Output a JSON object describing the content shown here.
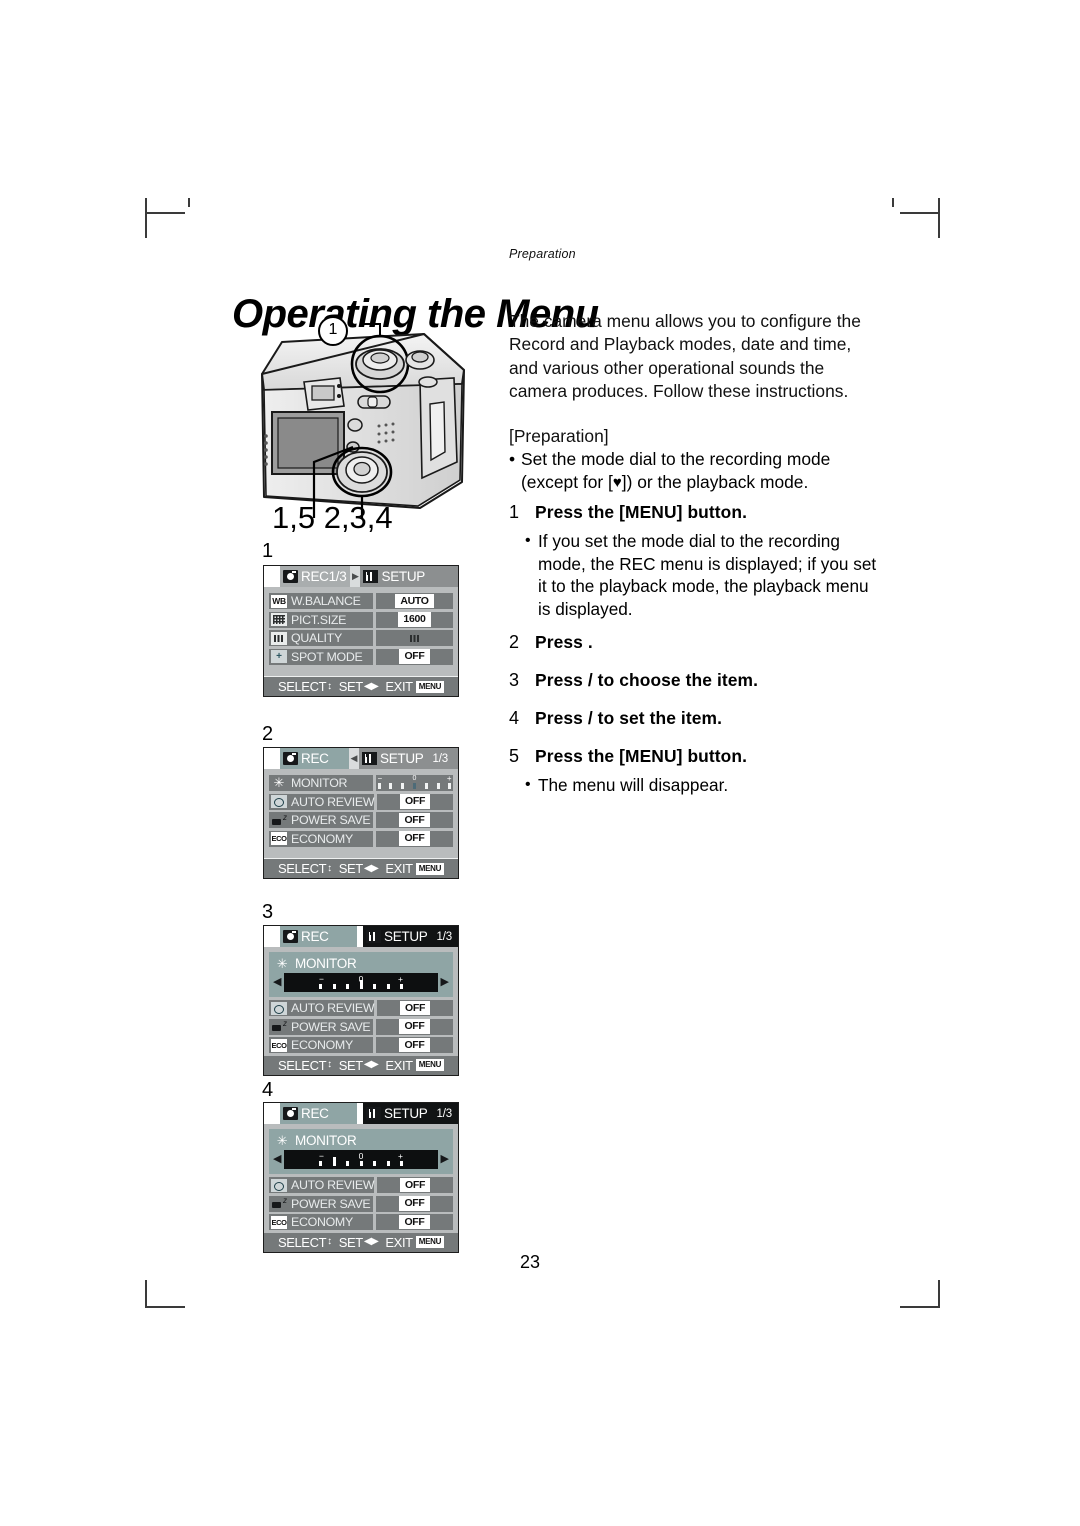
{
  "document": {
    "running_head": "Preparation",
    "title": "Operating the Menu",
    "page_number": "23"
  },
  "intro": {
    "paragraph": "The camera menu allows you to configure the Record and Playback modes, date and time, and various other operational sounds the camera produces. Follow these instructions.",
    "preparation_heading": "[Preparation]",
    "preparation_bullet_1": "Set the mode dial to the recording mode",
    "preparation_bullet_1_cont_pre": "(except for [",
    "preparation_bullet_1_cont_post": "]) or the playback mode.",
    "heart_glyph": "♥"
  },
  "steps": [
    {
      "num": "1",
      "text": "Press the [MENU] button.",
      "sub": "If you set the mode dial     to the recording mode,  the REC menu is displayed; if you set it to the playback mode, the playback menu is displayed."
    },
    {
      "num": "2",
      "text": "Press    ."
    },
    {
      "num": "3",
      "text": "Press   /   to choose the item."
    },
    {
      "num": "4",
      "text": "Press   /   to set the item."
    },
    {
      "num": "5",
      "text": "Press the [MENU] button.",
      "sub": "The menu will disappear."
    }
  ],
  "figure": {
    "callout_1": "1",
    "button_labels": "1,5  2,3,4",
    "camera_name": "digital-camera-rear-view"
  },
  "lcd_screens": [
    {
      "index": "1",
      "header": {
        "left_tab_label": "REC1/3",
        "left_tab_icon": "camera-icon",
        "separator_arrow": "▶",
        "right_tab_label": "SETUP",
        "right_tab_icon": "setup-tools-icon",
        "page_counter": ""
      },
      "rows": [
        {
          "icon": "wb-icon",
          "icon_text": "WB",
          "label": "W.BALANCE",
          "value": "AUTO",
          "value_type": "chip"
        },
        {
          "icon": "picture-size-icon",
          "icon_text": "",
          "label": "PICT.SIZE",
          "value": "1600",
          "value_type": "chip"
        },
        {
          "icon": "quality-icon",
          "icon_text": "",
          "label": "QUALITY",
          "value": "",
          "value_type": "icon"
        },
        {
          "icon": "spot-mode-icon",
          "icon_text": "+",
          "label": "SPOT MODE",
          "value": "OFF",
          "value_type": "chip"
        }
      ],
      "footer": {
        "select_label": "SELECT",
        "select_arrow": "↕",
        "set_label": "SET",
        "set_arrow": "◀▶",
        "exit_label": "EXIT",
        "exit_badge": "MENU"
      }
    },
    {
      "index": "2",
      "header": {
        "left_tab_label": "REC",
        "left_tab_icon": "camera-icon",
        "separator_arrow": "◀",
        "right_tab_label": "SETUP",
        "right_tab_icon": "setup-tools-icon",
        "page_counter": "1/3"
      },
      "rows": [
        {
          "icon": "sun-icon",
          "icon_text": "✳",
          "label": "MONITOR",
          "value": "",
          "value_type": "slider",
          "slider_cursor_index": 3
        },
        {
          "icon": "auto-review-icon",
          "icon_text": "",
          "label": "AUTO REVIEW",
          "value": "OFF",
          "value_type": "chip"
        },
        {
          "icon": "power-save-icon",
          "icon_text": "",
          "label": "POWER SAVE",
          "value": "OFF",
          "value_type": "chip"
        },
        {
          "icon": "economy-icon",
          "icon_text": "ECO",
          "label": "ECONOMY",
          "value": "OFF",
          "value_type": "chip"
        }
      ],
      "footer": {
        "select_label": "SELECT",
        "select_arrow": "↕",
        "set_label": "SET",
        "set_arrow": "◀▶",
        "exit_label": "EXIT",
        "exit_badge": "MENU"
      }
    },
    {
      "index": "3",
      "header": {
        "left_tab_label": "REC",
        "left_tab_icon": "camera-icon",
        "separator_arrow": "",
        "right_tab_label": "SETUP",
        "right_tab_icon": "setup-tools-icon",
        "page_counter": "1/3",
        "style": "dark"
      },
      "monitor_panel": {
        "icon": "sun-icon",
        "icon_text": "✳",
        "label": "MONITOR",
        "left_arrow": "◀",
        "right_arrow": "▶",
        "minus_sign": "−",
        "zero_label": "0",
        "plus_sign": "+",
        "cursor_index": 3
      },
      "rows": [
        {
          "icon": "auto-review-icon",
          "icon_text": "",
          "label": "AUTO REVIEW",
          "value": "OFF",
          "value_type": "chip"
        },
        {
          "icon": "power-save-icon",
          "icon_text": "",
          "label": "POWER SAVE",
          "value": "OFF",
          "value_type": "chip"
        },
        {
          "icon": "economy-icon",
          "icon_text": "ECO",
          "label": "ECONOMY",
          "value": "OFF",
          "value_type": "chip"
        }
      ],
      "footer": {
        "select_label": "SELECT",
        "select_arrow": "↕",
        "set_label": "SET",
        "set_arrow": "◀▶",
        "exit_label": "EXIT",
        "exit_badge": "MENU"
      }
    },
    {
      "index": "4",
      "header": {
        "left_tab_label": "REC",
        "left_tab_icon": "camera-icon",
        "separator_arrow": "",
        "right_tab_label": "SETUP",
        "right_tab_icon": "setup-tools-icon",
        "page_counter": "1/3",
        "style": "dark"
      },
      "monitor_panel": {
        "icon": "sun-icon",
        "icon_text": "✳",
        "label": "MONITOR",
        "left_arrow": "◀",
        "right_arrow": "▶",
        "minus_sign": "−",
        "zero_label": "0",
        "plus_sign": "+",
        "cursor_index": 1
      },
      "rows": [
        {
          "icon": "auto-review-icon",
          "icon_text": "",
          "label": "AUTO REVIEW",
          "value": "OFF",
          "value_type": "chip"
        },
        {
          "icon": "power-save-icon",
          "icon_text": "",
          "label": "POWER SAVE",
          "value": "OFF",
          "value_type": "chip"
        },
        {
          "icon": "economy-icon",
          "icon_text": "ECO",
          "label": "ECONOMY",
          "value": "OFF",
          "value_type": "chip"
        }
      ],
      "footer": {
        "select_label": "SELECT",
        "select_arrow": "↕",
        "set_label": "SET",
        "set_arrow": "◀▶",
        "exit_label": "EXIT",
        "exit_badge": "MENU"
      }
    }
  ],
  "colors": {
    "lcd_background": "#b9bcbd",
    "lcd_row": "#75797a",
    "lcd_header": "#8c8f90",
    "lcd_header_dark": "#111314",
    "monitor_panel": "#8fa5a5",
    "ink": "#000000"
  }
}
